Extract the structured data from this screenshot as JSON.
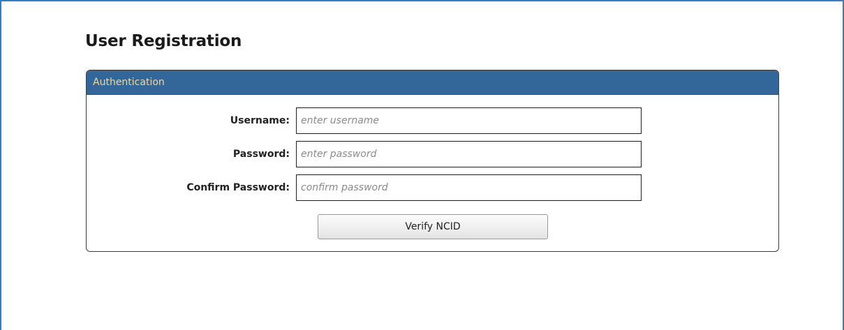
{
  "page": {
    "title": "User Registration"
  },
  "panel": {
    "header": "Authentication",
    "fields": [
      {
        "label": "Username:",
        "value": "",
        "placeholder": "enter username"
      },
      {
        "label": "Password:",
        "value": "",
        "placeholder": "enter password"
      },
      {
        "label": "Confirm Password:",
        "value": "",
        "placeholder": "confirm password"
      }
    ],
    "button_label": "Verify NCID"
  },
  "colors": {
    "frame_border": "#3a7cc4",
    "header_background": "#336699",
    "header_text": "#f0d89a"
  }
}
